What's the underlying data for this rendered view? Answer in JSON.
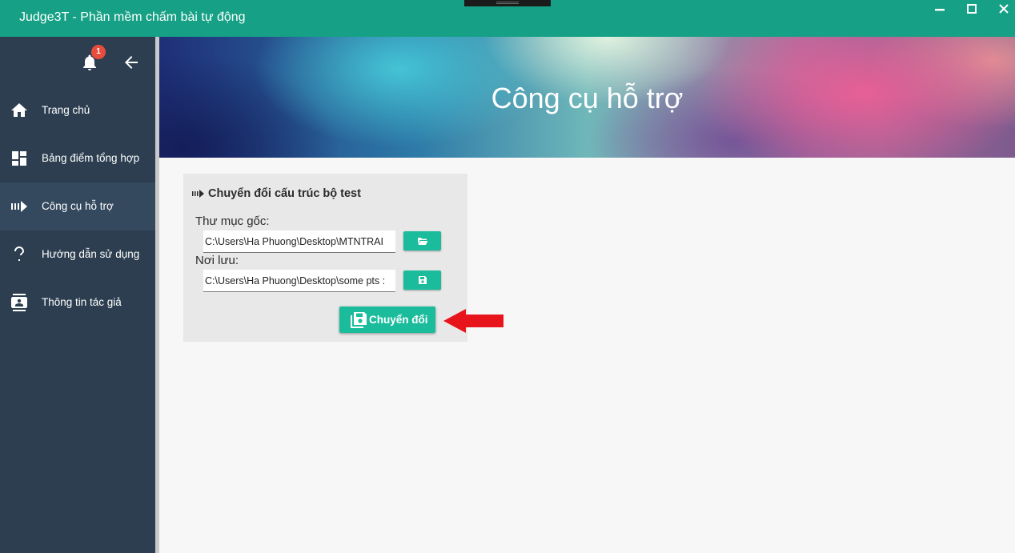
{
  "window": {
    "title": "Judge3T - Phần mềm chấm bài tự động"
  },
  "sidebar": {
    "notification_count": "1",
    "items": [
      {
        "label": "Trang chủ",
        "icon": "home-icon"
      },
      {
        "label": "Bảng điểm tổng hợp",
        "icon": "dashboard-icon"
      },
      {
        "label": "Công cụ hỗ trợ",
        "icon": "tools-icon",
        "active": true
      },
      {
        "label": "Hướng dẫn sử dụng",
        "icon": "help-icon"
      },
      {
        "label": "Thông tin tác giả",
        "icon": "contact-icon"
      }
    ]
  },
  "banner": {
    "title": "Công cụ hỗ trợ"
  },
  "panel": {
    "title": "Chuyển đổi cấu trúc bộ test",
    "source_label": "Thư mục gốc:",
    "source_value": "C:\\Users\\Ha Phuong\\Desktop\\MTNTRAI",
    "dest_label": "Nơi lưu:",
    "dest_value": "C:\\Users\\Ha Phuong\\Desktop\\some pts :",
    "convert_label": "Chuyển đổi"
  },
  "colors": {
    "accent": "#16a085",
    "button": "#1abc9c",
    "sidebar": "#2c3e50",
    "badge": "#e74c3c",
    "annotation_arrow": "#e8141b"
  }
}
